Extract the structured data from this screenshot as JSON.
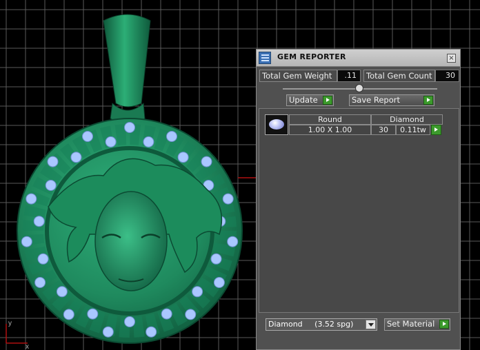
{
  "viewport": {
    "background": "#000000",
    "grid_color": "#5a5a5a",
    "model_color": "#1f8a5e",
    "gem_color": "#a9c7ff",
    "axis_labels": [
      "y",
      "x"
    ]
  },
  "gem_reporter": {
    "title": "GEM REPORTER",
    "close_label": "×",
    "total_weight_label": "Total Gem Weight",
    "total_weight_value": ".11",
    "total_count_label": "Total Gem Count",
    "total_count_value": "30",
    "update_label": "Update",
    "save_report_label": "Save Report",
    "gem_row": {
      "shape": "Round",
      "material": "Diamond",
      "size": "1.00 X 1.00",
      "count": "30",
      "weight": "0.11tw"
    },
    "material_select_value": "Diamond     (3.52 spg)",
    "set_material_label": "Set Material"
  }
}
